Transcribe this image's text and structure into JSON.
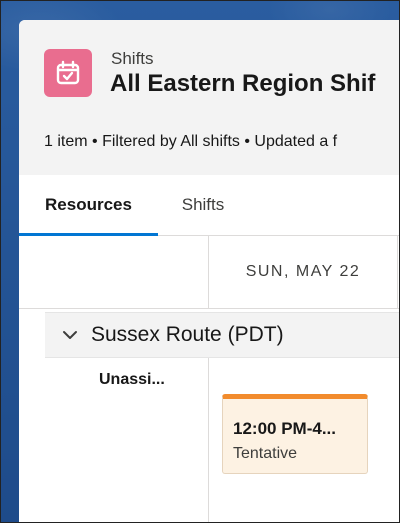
{
  "header": {
    "object_label": "Shifts",
    "title": "All Eastern Region Shif",
    "subtitle": "1 item • Filtered by All shifts • Updated a f",
    "icon": "calendar-check-icon",
    "icon_color": "#e96d8f"
  },
  "tabs": [
    {
      "label": "Resources",
      "selected": true
    },
    {
      "label": "Shifts",
      "selected": false
    }
  ],
  "schedule": {
    "date_header": "SUN, MAY 22",
    "group": {
      "label": "Sussex Route (PDT)",
      "icon": "chevron-down-icon",
      "expanded": true
    },
    "resource": {
      "name": "Unassi..."
    },
    "shift": {
      "time": "12:00 PM-4...",
      "status": "Tentative",
      "accent_color": "#f28b2c",
      "background_color": "#fdf2e3"
    }
  },
  "colors": {
    "tab_selected_underline": "#0176d3",
    "background_blue": "#1f4f8f"
  }
}
